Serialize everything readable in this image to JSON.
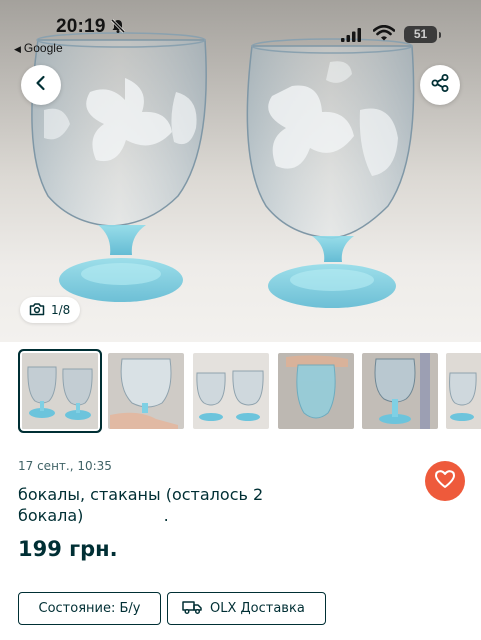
{
  "status_bar": {
    "time": "20:19",
    "back_app": "Google",
    "battery": "51"
  },
  "gallery": {
    "counter": "1/8",
    "thumbnail_count": 6
  },
  "ad": {
    "date": "17 сент., 10:35",
    "title": "бокалы, стаканы (осталось 2 бокала)",
    "title_suffix": ".",
    "price": "199 грн."
  },
  "chips": {
    "condition": "Состояние: Б/у",
    "delivery": "OLX Доставка"
  },
  "colors": {
    "accent": "#ee5a3b",
    "text": "#002f34",
    "glass_blue": "#7fd0e4"
  },
  "icons": [
    "bell-off-icon",
    "signal-icon",
    "wifi-icon",
    "battery-icon",
    "back-arrow-icon",
    "share-icon",
    "camera-icon",
    "heart-icon",
    "truck-icon"
  ]
}
